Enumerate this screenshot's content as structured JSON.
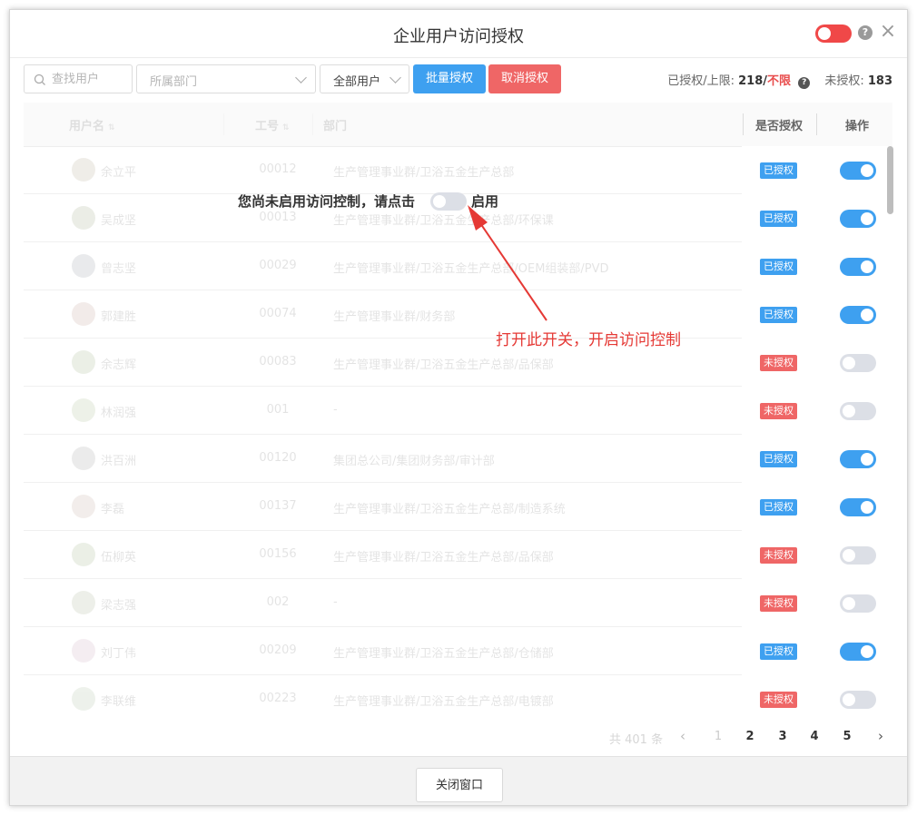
{
  "dialog": {
    "title": "企业用户访问授权",
    "access_control_enabled": false,
    "help_icon": "question-circle-icon",
    "close_icon": "close-icon"
  },
  "toolbar": {
    "search_placeholder": "查找用户",
    "dept_placeholder": "所属部门",
    "user_filter_value": "全部用户",
    "batch_authorize_label": "批量授权",
    "cancel_authorize_label": "取消授权"
  },
  "stats": {
    "authorized_label": "已授权/上限:",
    "authorized_count": "218",
    "slash": "/",
    "limit": "不限",
    "unauthorized_label": "未授权:",
    "unauthorized_count": "183"
  },
  "table": {
    "headers": {
      "username": "用户名",
      "emp_no": "工号",
      "dept": "部门",
      "authorized": "是否授权",
      "action": "操作"
    },
    "rows": [
      {
        "name": "余立平",
        "id": "00012",
        "dept": "生产管理事业群/卫浴五金生产总部",
        "status": "已授权",
        "on": true
      },
      {
        "name": "吴成坚",
        "id": "00013",
        "dept": "生产管理事业群/卫浴五金生产总部/环保课",
        "status": "已授权",
        "on": true
      },
      {
        "name": "曾志坚",
        "id": "00029",
        "dept": "生产管理事业群/卫浴五金生产总部/OEM组装部/PVD",
        "status": "已授权",
        "on": true
      },
      {
        "name": "郭建胜",
        "id": "00074",
        "dept": "生产管理事业群/财务部",
        "status": "已授权",
        "on": true
      },
      {
        "name": "余志辉",
        "id": "00083",
        "dept": "生产管理事业群/卫浴五金生产总部/品保部",
        "status": "未授权",
        "on": false
      },
      {
        "name": "林润强",
        "id": "001",
        "dept": "-",
        "status": "未授权",
        "on": false
      },
      {
        "name": "洪百洲",
        "id": "00120",
        "dept": "集团总公司/集团财务部/审计部",
        "status": "已授权",
        "on": true
      },
      {
        "name": "李磊",
        "id": "00137",
        "dept": "生产管理事业群/卫浴五金生产总部/制造系统",
        "status": "已授权",
        "on": true
      },
      {
        "name": "伍柳英",
        "id": "00156",
        "dept": "生产管理事业群/卫浴五金生产总部/品保部",
        "status": "未授权",
        "on": false
      },
      {
        "name": "梁志强",
        "id": "002",
        "dept": "-",
        "status": "未授权",
        "on": false
      },
      {
        "name": "刘丁伟",
        "id": "00209",
        "dept": "生产管理事业群/卫浴五金生产总部/仓储部",
        "status": "已授权",
        "on": true
      },
      {
        "name": "李联维",
        "id": "00223",
        "dept": "生产管理事业群/卫浴五金生产总部/电镀部",
        "status": "未授权",
        "on": false
      }
    ]
  },
  "overlay": {
    "message_before": "您尚未启用访问控制，请点击",
    "message_after": "启用",
    "annotation": "打开此开关，开启访问控制"
  },
  "pagination": {
    "total": "共 401 条",
    "pages": [
      "1",
      "2",
      "3",
      "4",
      "5"
    ],
    "prev_icon": "chevron-left-icon",
    "next_icon": "chevron-right-icon"
  },
  "footer": {
    "close_label": "关闭窗口"
  },
  "colors": {
    "primary": "#3ea0f0",
    "danger": "#ef6666",
    "annotation": "#e53935"
  }
}
